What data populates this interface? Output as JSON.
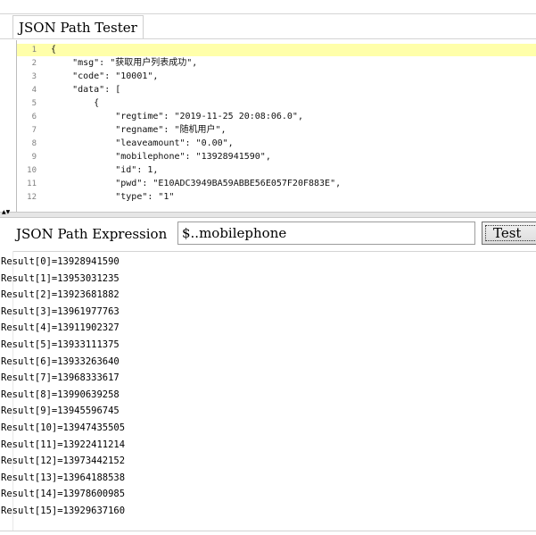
{
  "tab": {
    "label": "JSON Path Tester"
  },
  "editor": {
    "lines": [
      {
        "num": "1",
        "text": "{"
      },
      {
        "num": "2",
        "text": "    \"msg\": \"获取用户列表成功\","
      },
      {
        "num": "3",
        "text": "    \"code\": \"10001\","
      },
      {
        "num": "4",
        "text": "    \"data\": ["
      },
      {
        "num": "5",
        "text": "        {"
      },
      {
        "num": "6",
        "text": "            \"regtime\": \"2019-11-25 20:08:06.0\","
      },
      {
        "num": "7",
        "text": "            \"regname\": \"随机用户\","
      },
      {
        "num": "8",
        "text": "            \"leaveamount\": \"0.00\","
      },
      {
        "num": "9",
        "text": "            \"mobilephone\": \"13928941590\","
      },
      {
        "num": "10",
        "text": "            \"id\": 1,"
      },
      {
        "num": "11",
        "text": "            \"pwd\": \"E10ADC3949BA59ABBE56E057F20F883E\","
      },
      {
        "num": "12",
        "text": "            \"type\": \"1\""
      }
    ]
  },
  "expression": {
    "label": "JSON Path Expression",
    "value": "$..mobilephone",
    "test_label": "Test"
  },
  "results": [
    "Result[0]=13928941590",
    "Result[1]=13953031235",
    "Result[2]=13923681882",
    "Result[3]=13961977763",
    "Result[4]=13911902327",
    "Result[5]=13933111375",
    "Result[6]=13933263640",
    "Result[7]=13968333617",
    "Result[8]=13990639258",
    "Result[9]=13945596745",
    "Result[10]=13947435505",
    "Result[11]=13922411214",
    "Result[12]=13973442152",
    "Result[13]=13964188538",
    "Result[14]=13978600985",
    "Result[15]=13929637160"
  ]
}
